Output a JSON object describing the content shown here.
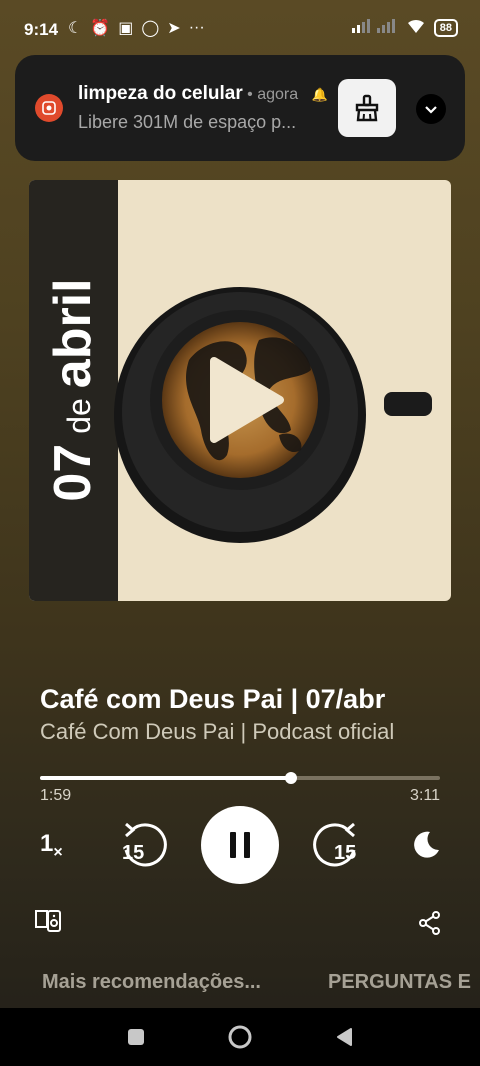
{
  "status": {
    "time": "9:14",
    "battery": "88"
  },
  "notification": {
    "app_name": "limpeza do celular",
    "meta": " • agora",
    "body": "Libere 301M de espaço p..."
  },
  "cover": {
    "day": "07",
    "de": "de",
    "month": "abril"
  },
  "episode": {
    "title": "Café com Deus Pai | 07/abr",
    "show": "Café Com Deus Pai | Podcast oficial"
  },
  "player": {
    "elapsed": "1:59",
    "total": "3:11",
    "progress_fraction": 0.628,
    "speed": "1",
    "speed_suffix": "×",
    "skip_back_seconds": "15",
    "skip_forward_seconds": "15"
  },
  "tabs": {
    "recommendations": "Mais recomendações...",
    "faq": "PERGUNTAS E"
  },
  "colors": {
    "accent": "#ffffff",
    "notification_icon": "#e04a2c",
    "cover_background": "#ede1c7"
  },
  "icons": {
    "status_left": [
      "moon-icon",
      "alarm-icon",
      "notification-app-icon",
      "whatsapp-icon",
      "telegram-icon",
      "more-icon"
    ],
    "status_right": [
      "signal-icon",
      "wifi-icon",
      "battery-icon"
    ]
  }
}
